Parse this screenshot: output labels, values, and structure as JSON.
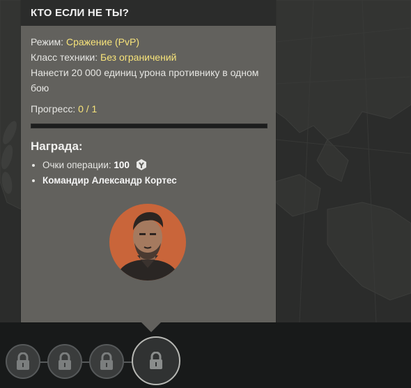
{
  "header": {
    "title": "Кто если не ты?"
  },
  "mission": {
    "mode_label": "Режим:",
    "mode_value": "Сражение (PvP)",
    "class_label": "Класс техники:",
    "class_value": "Без ограничений",
    "description": "Нанести 20 000 единиц урона противнику в одном бою",
    "progress_label": "Прогресс:",
    "progress_value": "0 / 1",
    "progress_fraction": 0
  },
  "reward": {
    "title": "Награда:",
    "points_label": "Очки операции:",
    "points_value": "100",
    "points_icon": "operation-points-icon",
    "commander": "Командир Александр Кортес"
  },
  "colors": {
    "highlight": "#f7e37a",
    "panel": "#62615d",
    "header_bg": "#2b2c2b",
    "avatar_bg": "#c9653a"
  },
  "operation_nodes": [
    {
      "state": "locked",
      "icon": "lock-icon"
    },
    {
      "state": "locked",
      "icon": "lock-icon"
    },
    {
      "state": "locked",
      "icon": "lock-icon"
    },
    {
      "state": "locked-selected",
      "icon": "lock-icon"
    }
  ]
}
